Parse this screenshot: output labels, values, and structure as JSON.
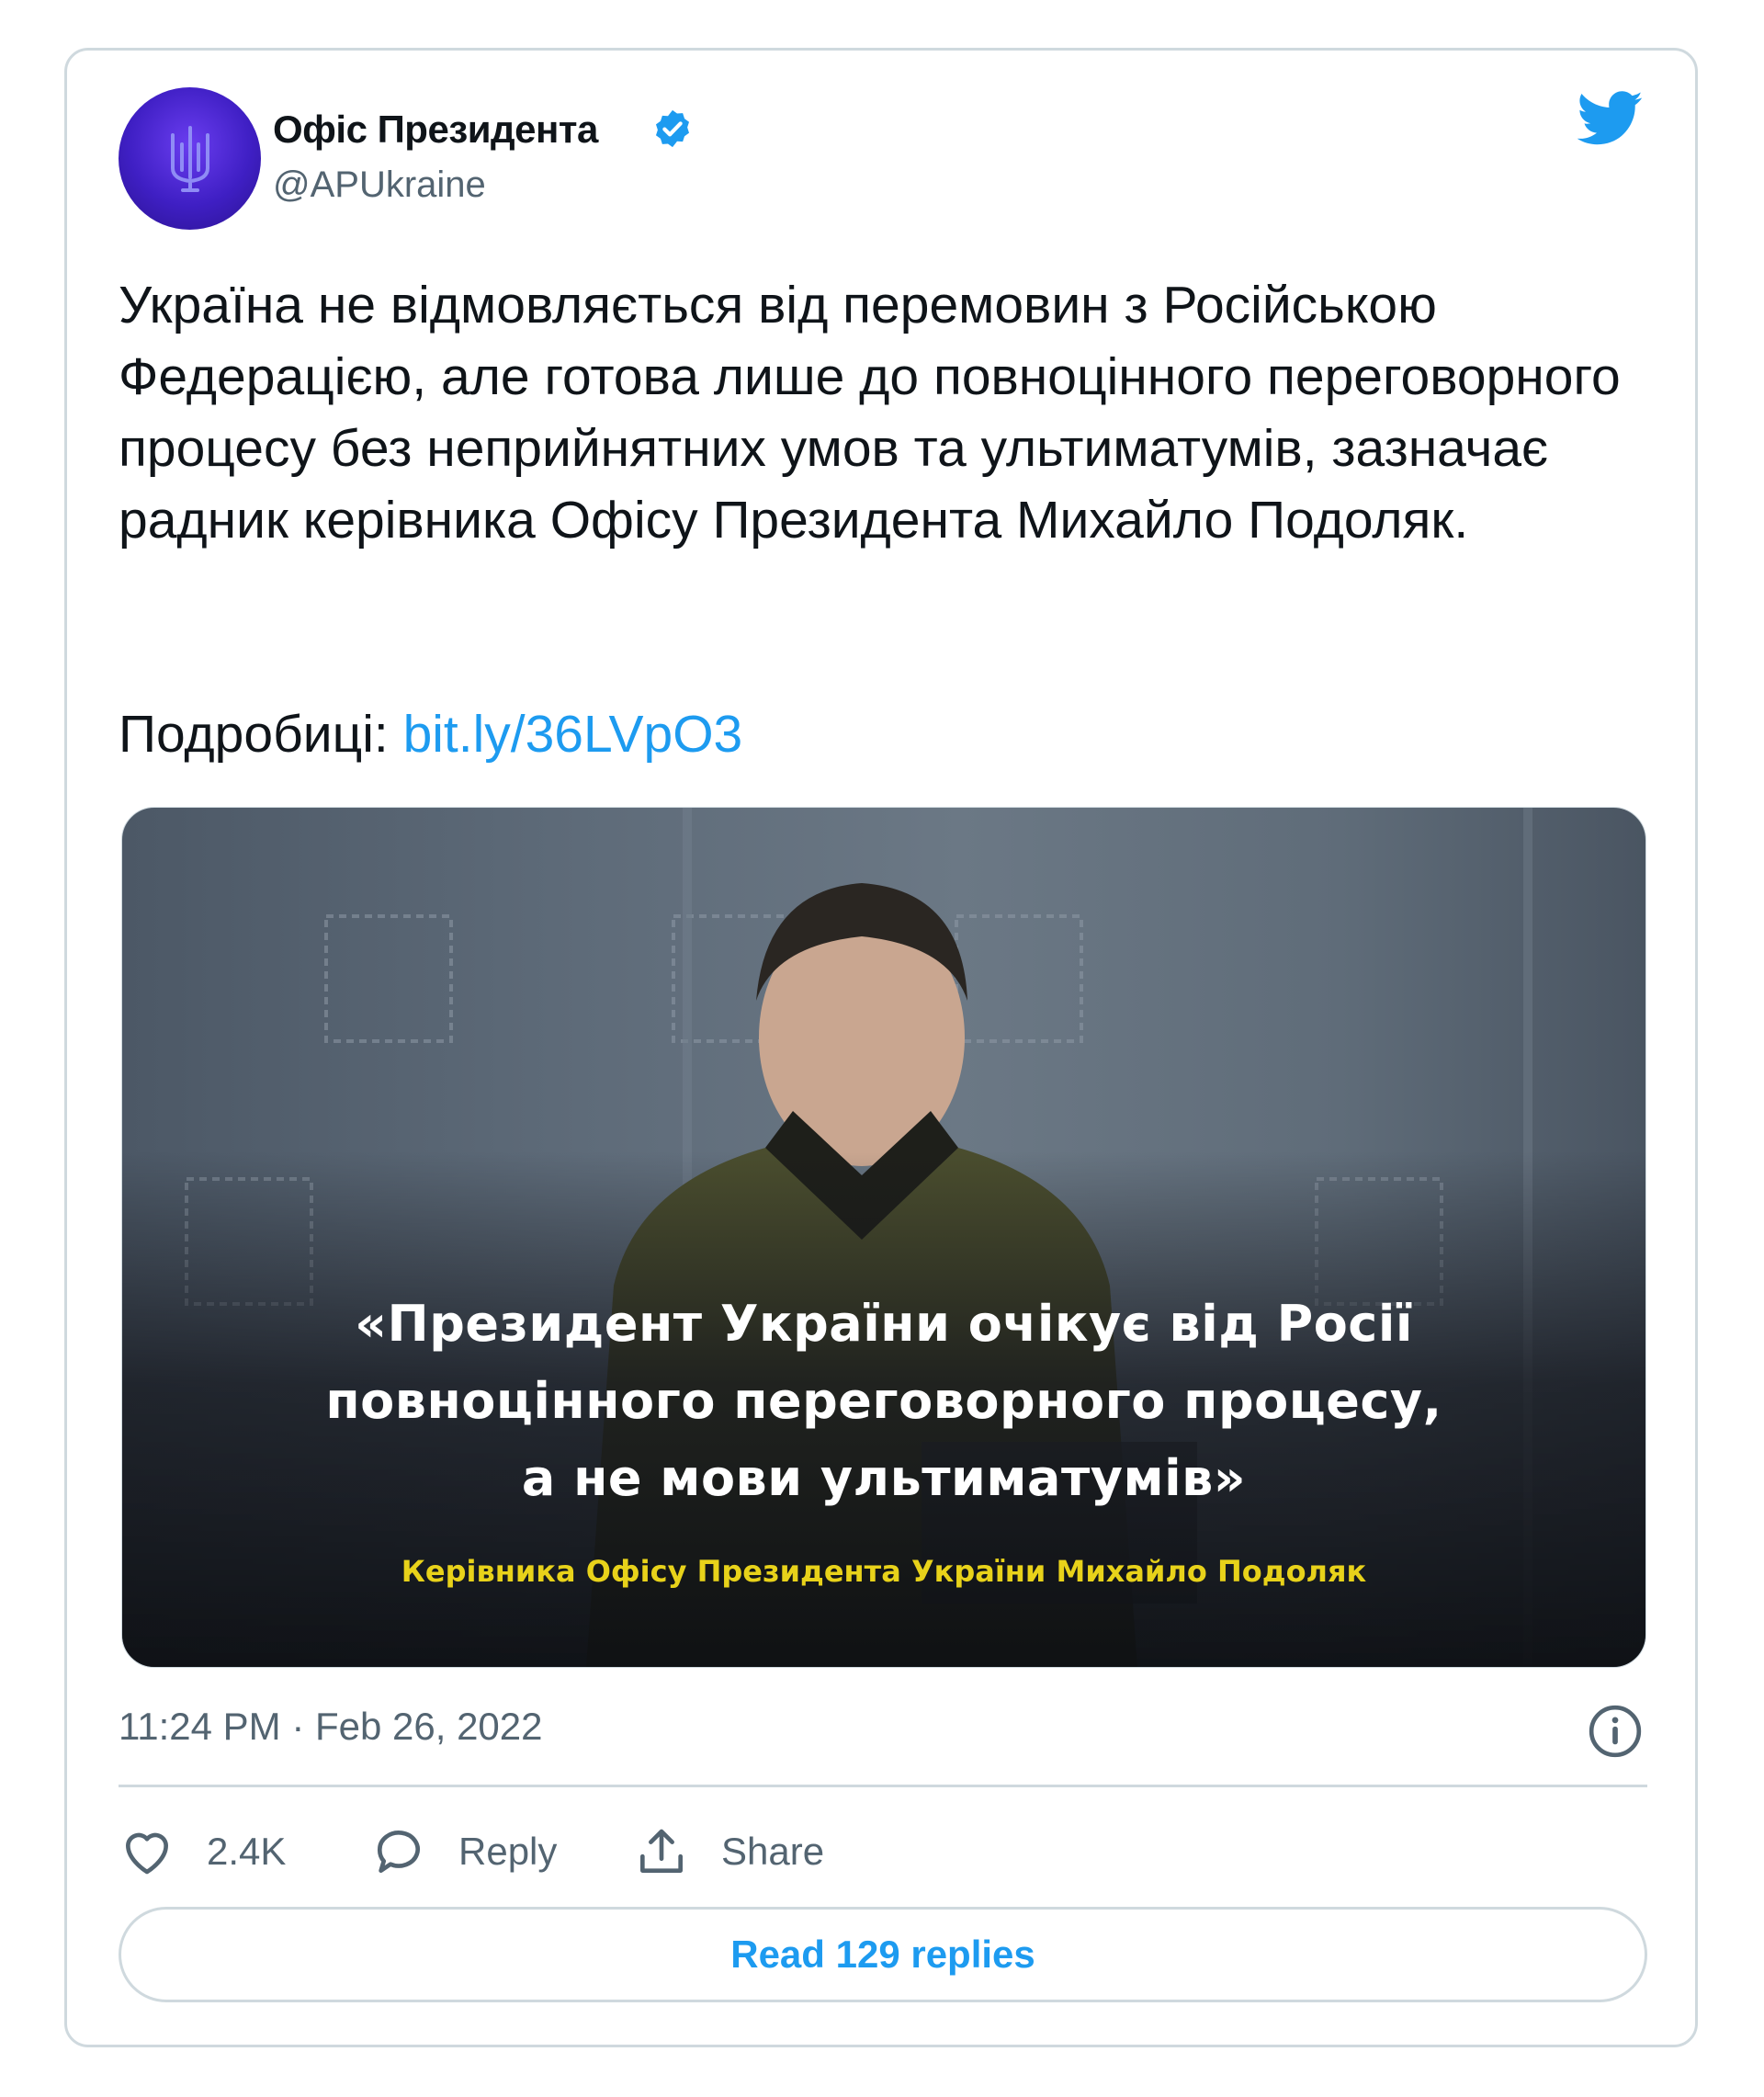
{
  "tweet": {
    "author_name": "Офіс Президента",
    "handle": "@APUkraine",
    "text": "Україна не відмовляється від перемовин з Російською Федерацією, але готова лише до повноцінного переговорного процесу без неприйнятних умов та ультиматумів, зазначає радник керівника Офісу Президента Михайло Подоляк.",
    "details_label": "Подробиці: ",
    "link_text": "bit.ly/36LVpO3",
    "timestamp": "11:24 PM · Feb 26, 2022"
  },
  "media": {
    "quote_lines": [
      "«Президент України очікує від Росії",
      "повноцінного переговорного процесу,",
      "а не мови ультиматумів»"
    ],
    "caption": "Керівника Офісу Президента України Михайло Подоляк"
  },
  "actions": {
    "likes": "2.4K",
    "reply_label": "Reply",
    "share_label": "Share",
    "read_replies_label": "Read 129 replies"
  },
  "icons": {
    "verified": "verified-badge-icon",
    "twitter": "twitter-bird-icon",
    "info": "info-icon",
    "like": "heart-icon",
    "reply": "speech-bubble-icon",
    "share": "share-upload-icon"
  },
  "colors": {
    "accent": "#1d9bf0",
    "text": "#0f1419",
    "secondary": "#536471",
    "border": "#cfd9de",
    "caption": "#e8d21a"
  }
}
